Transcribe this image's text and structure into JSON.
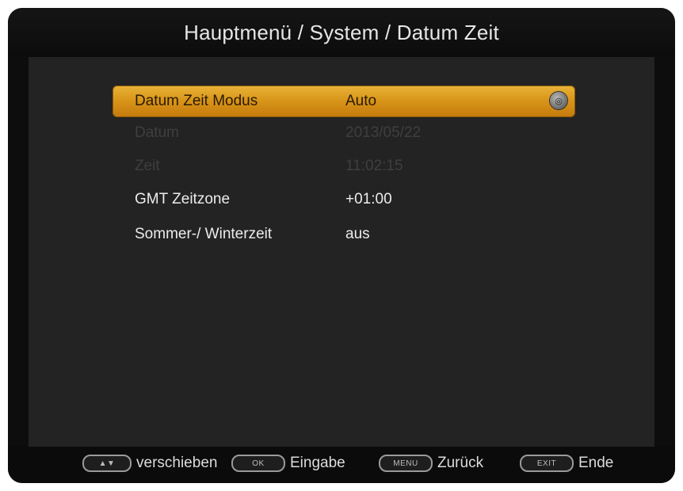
{
  "title": "Hauptmenü / System / Datum Zeit",
  "menu": {
    "items": [
      {
        "label": "Datum Zeit Modus",
        "value": "Auto"
      },
      {
        "label": "Datum",
        "value": "2013/05/22"
      },
      {
        "label": "Zeit",
        "value": "11:02:15"
      },
      {
        "label": "GMT Zeitzone",
        "value": "+01:00"
      },
      {
        "label": "Sommer-/ Winterzeit",
        "value": "aus"
      }
    ]
  },
  "footer": {
    "move": {
      "key": "▲▼",
      "label": "verschieben"
    },
    "ok": {
      "key": "OK",
      "label": "Eingabe"
    },
    "menu": {
      "key": "MENU",
      "label": "Zurück"
    },
    "exit": {
      "key": "EXIT",
      "label": "Ende"
    }
  },
  "colors": {
    "highlight": "#d9961a",
    "background": "#232323",
    "text": "#ececec",
    "disabled_text": "#3f3f3f"
  }
}
